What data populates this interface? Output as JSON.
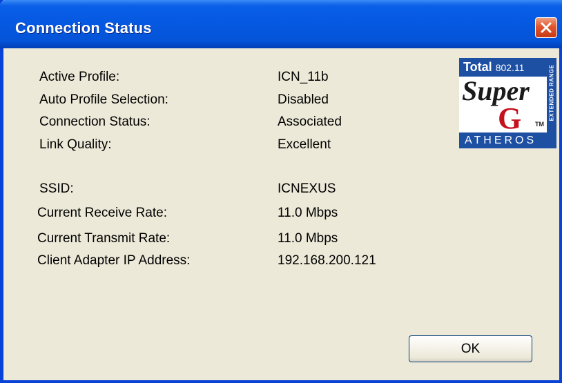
{
  "window": {
    "title": "Connection Status",
    "close_icon": "close-icon"
  },
  "status": {
    "active_profile_label": "Active Profile:",
    "active_profile_value": "ICN_11b",
    "auto_profile_label": "Auto Profile Selection:",
    "auto_profile_value": "Disabled",
    "connection_status_label": "Connection Status:",
    "connection_status_value": "Associated",
    "link_quality_label": "Link Quality:",
    "link_quality_value": "Excellent",
    "ssid_label": "SSID:",
    "ssid_value": "ICNEXUS",
    "receive_rate_label": "Current Receive Rate:",
    "receive_rate_value": "11.0 Mbps",
    "transmit_rate_label": "Current Transmit Rate:",
    "transmit_rate_value": "11.0 Mbps",
    "ip_label": "Client Adapter IP Address:",
    "ip_value": "192.168.200.121"
  },
  "logo": {
    "total": "Total",
    "standard": "802.11",
    "super": "Super",
    "g": "G",
    "tm": "TM",
    "atheros": "ATHEROS",
    "extended": "EXTENDED RANGE"
  },
  "buttons": {
    "ok_label": "OK"
  },
  "colors": {
    "titlebar": "#0558e0",
    "face": "#ece9d8",
    "close": "#e2562e",
    "logo_blue": "#1d4fa3",
    "logo_red": "#c5101e"
  }
}
